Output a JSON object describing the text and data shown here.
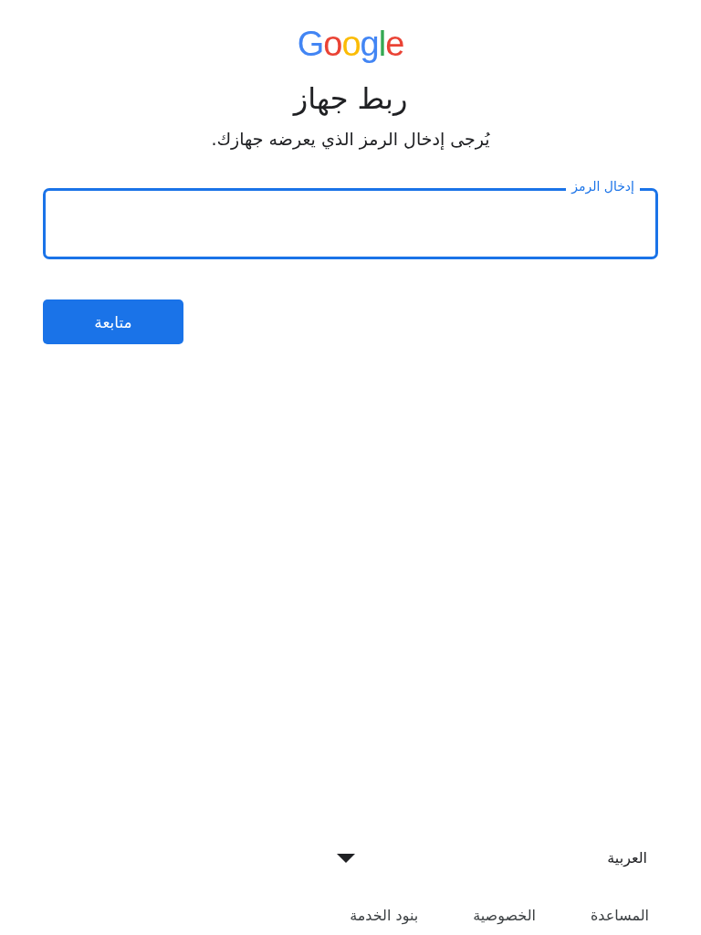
{
  "logo": "Google",
  "title": "ربط جهاز",
  "subtitle": "يُرجى إدخال الرمز الذي يعرضه جهازك.",
  "code_field": {
    "label": "إدخال الرمز"
  },
  "continue_button": "متابعة",
  "language_select": {
    "value": "العربية"
  },
  "footer_links": [
    "المساعدة",
    "الخصوصية",
    "بنود الخدمة"
  ]
}
